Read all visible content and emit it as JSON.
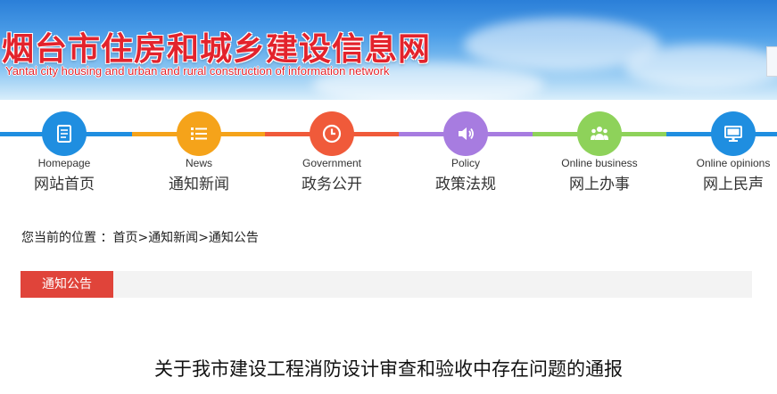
{
  "header": {
    "title_cn": "烟台市住房和城乡建设信息网",
    "title_en": "Yantai city housing and urban and rural construction of information network"
  },
  "nav": {
    "items": [
      {
        "en": "Homepage",
        "cn": "网站首页",
        "icon": "document-icon",
        "color": "#1f8ee0",
        "line": "#1f8ee0"
      },
      {
        "en": "News",
        "cn": "通知新闻",
        "icon": "list-icon",
        "color": "#f5a31a",
        "line": "#f5a31a"
      },
      {
        "en": "Government",
        "cn": "政务公开",
        "icon": "clock-icon",
        "color": "#f05a3a",
        "line": "#f05a3a"
      },
      {
        "en": "Policy",
        "cn": "政策法规",
        "icon": "speaker-icon",
        "color": "#a77ce0",
        "line": "#a77ce0"
      },
      {
        "en": "Online business",
        "cn": "网上办事",
        "icon": "people-icon",
        "color": "#8ed25a",
        "line": "#8ed25a"
      },
      {
        "en": "Online opinions",
        "cn": "网上民声",
        "icon": "monitor-icon",
        "color": "#1f8ee0",
        "line": "#1f8ee0"
      }
    ]
  },
  "breadcrumb": {
    "prefix": "您当前的位置 ：",
    "home": "首页",
    "sep1": ">",
    "news": "通知新闻",
    "sep2": ">",
    "current": "通知公告"
  },
  "section": {
    "tab_label": "通知公告",
    "tab_color": "#e0443a"
  },
  "article": {
    "title": "关于我市建设工程消防设计审查和验收中存在问题的通报"
  }
}
